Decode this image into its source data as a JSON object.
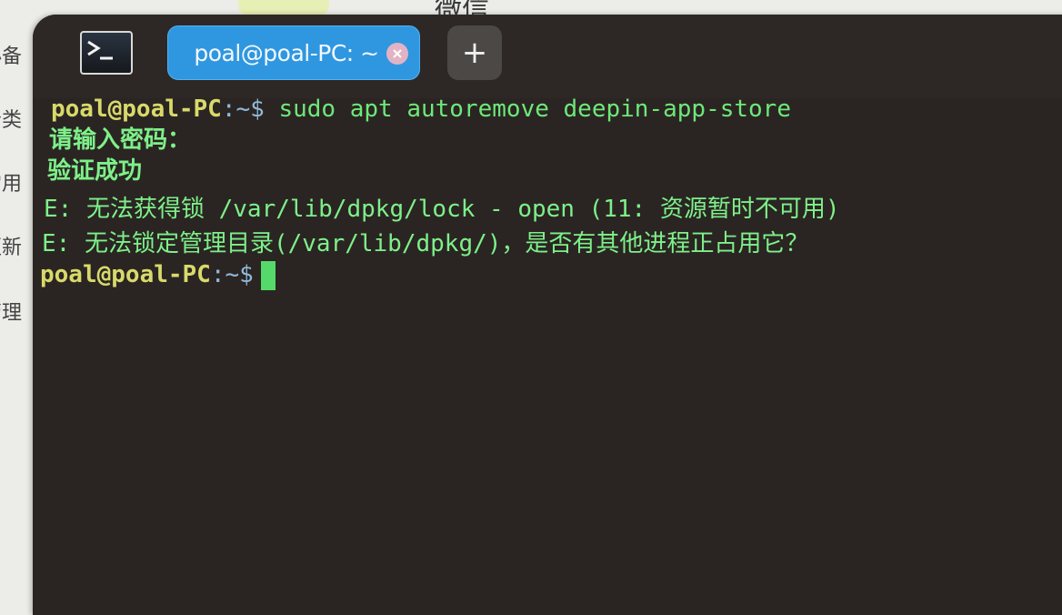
{
  "background_app": {
    "title": "微信",
    "sidebar": [
      "必备",
      "分类",
      "常用",
      "更新",
      "管理"
    ]
  },
  "terminal": {
    "tab_label": "poal@poal-PC: ~",
    "add_tab_label": "+",
    "lines": {
      "l1": {
        "user": "poal@poal-PC",
        "sep": ":",
        "path": "~$",
        "command": " sudo apt autoremove deepin-app-store"
      },
      "l2": "请输入密码：",
      "l3": "验证成功",
      "l4": "E: 无法获得锁 /var/lib/dpkg/lock - open (11: 资源暂时不可用)",
      "l5": "E: 无法锁定管理目录(/var/lib/dpkg/)，是否有其他进程正占用它？",
      "l6": {
        "user": "poal@poal-PC",
        "sep": ":",
        "path": "~$"
      }
    }
  },
  "icons": {
    "terminal_app": "terminal-icon",
    "tab_close": "close-icon",
    "add_tab": "plus-icon"
  },
  "colors": {
    "terminal_bg": "#2a2522",
    "tab_active": "#2f97e0",
    "prompt_user": "#d9d96b",
    "output_text": "#7ef08a",
    "cursor": "#55d96a"
  }
}
